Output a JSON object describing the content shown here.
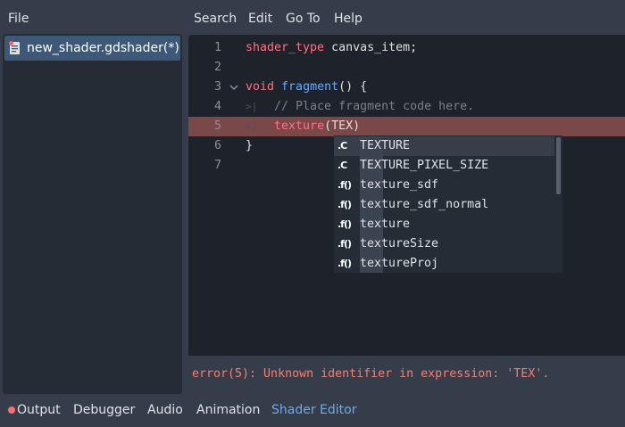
{
  "menu": {
    "file": "File",
    "search": "Search",
    "edit": "Edit",
    "goto": "Go To",
    "help": "Help"
  },
  "files": [
    {
      "label": "new_shader.gdshader(*)"
    }
  ],
  "editor": {
    "lines": [
      {
        "num": "1",
        "parts": [
          {
            "t": "shader_type",
            "c": "kw"
          },
          {
            "t": " canvas_item;",
            "c": "pl"
          }
        ]
      },
      {
        "num": "2",
        "parts": []
      },
      {
        "num": "3",
        "parts": [
          {
            "t": "void",
            "c": "kw"
          },
          {
            "t": " ",
            "c": "pl"
          },
          {
            "t": "fragment",
            "c": "fn"
          },
          {
            "t": "() {",
            "c": "pl"
          }
        ]
      },
      {
        "num": "4",
        "parts": [
          {
            "t": "    // Place fragment code here.",
            "c": "cm"
          }
        ]
      },
      {
        "num": "5",
        "parts": [
          {
            "t": "    ",
            "c": "pl"
          },
          {
            "t": "texture",
            "c": "bi"
          },
          {
            "t": "(TEX)",
            "c": "pl"
          }
        ]
      },
      {
        "num": "6",
        "parts": [
          {
            "t": "}",
            "c": "pl"
          }
        ]
      },
      {
        "num": "7",
        "parts": []
      }
    ]
  },
  "autocomplete": {
    "items": [
      {
        "icon": ".C",
        "label": "TEXTURE"
      },
      {
        "icon": ".C",
        "label": "TEXTURE_PIXEL_SIZE"
      },
      {
        "icon": ".f()",
        "label": "texture_sdf"
      },
      {
        "icon": ".f()",
        "label": "texture_sdf_normal"
      },
      {
        "icon": ".f()",
        "label": "texture"
      },
      {
        "icon": ".f()",
        "label": "textureSize"
      },
      {
        "icon": ".f()",
        "label": "textureProj"
      }
    ]
  },
  "status": {
    "error": "error(5): Unknown identifier in expression: 'TEX'."
  },
  "bottom_tabs": {
    "output": "Output",
    "debugger": "Debugger",
    "audio": "Audio",
    "animation": "Animation",
    "shader_editor": "Shader Editor"
  },
  "colors": {
    "keyword": "#ff7085",
    "function": "#66aaff",
    "error_text": "#ff7a6b",
    "active_tab": "#74a7e8"
  }
}
